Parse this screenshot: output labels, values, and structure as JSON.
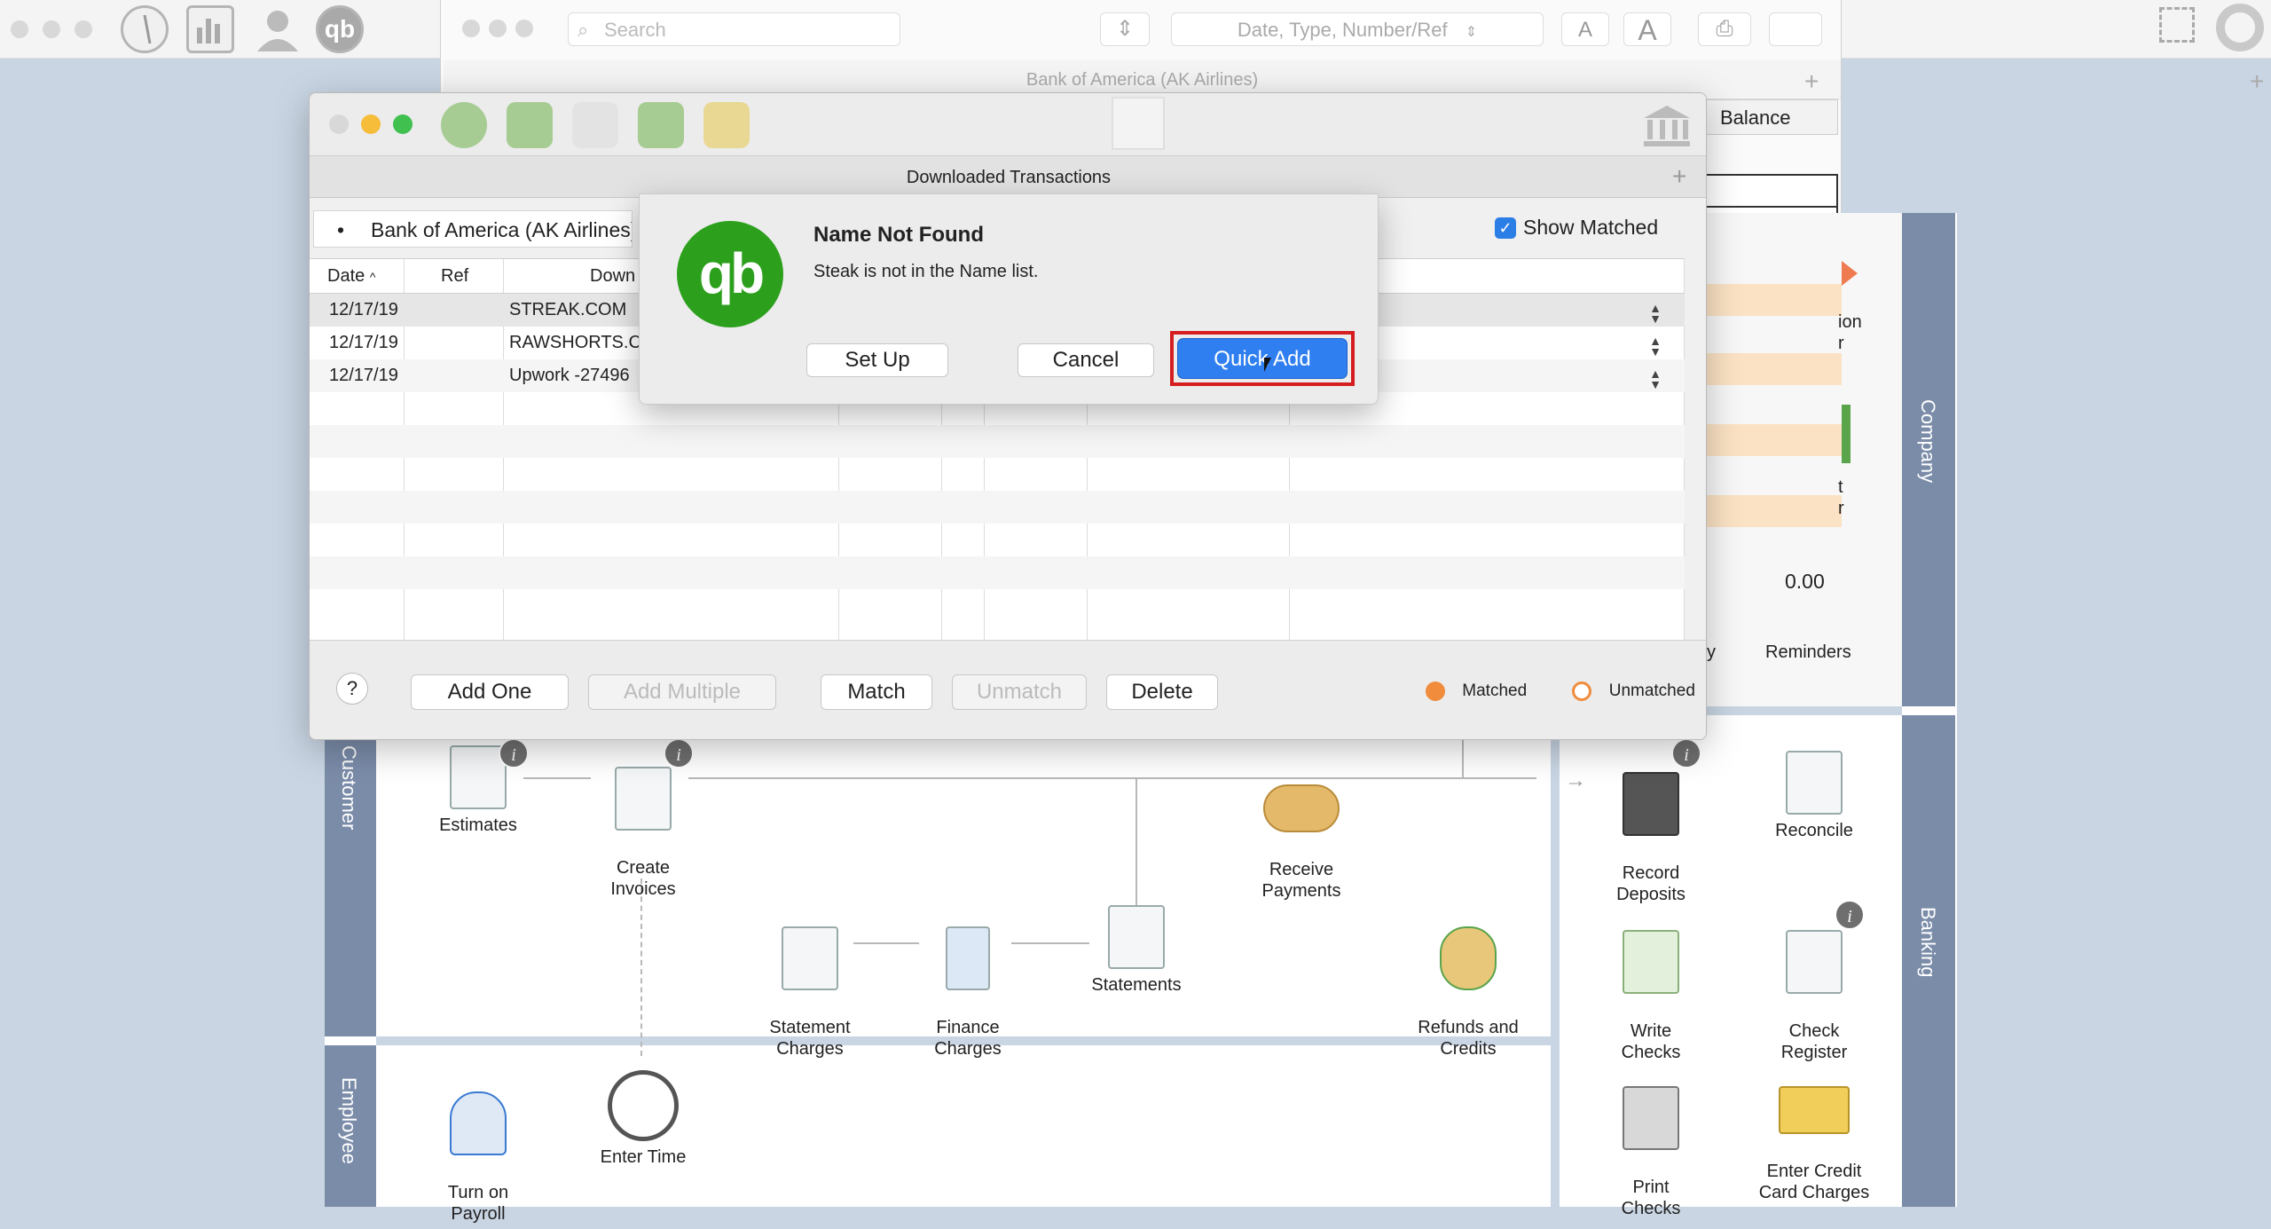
{
  "topbar": {
    "icons": [
      "traffic-lights",
      "compass-icon",
      "bar-chart-icon",
      "user-icon",
      "qb-icon"
    ],
    "search_placeholder": "Search",
    "sort_dropdown": "Date, Type, Number/Ref",
    "font_small": "A",
    "font_large": "A"
  },
  "register": {
    "title": "Bank of America (AK Airlines)",
    "balance_header": "Balance",
    "balance_value": "0.00",
    "side_labels": [
      "ion",
      "r",
      "t",
      "r"
    ],
    "reminders_label": "Reminders",
    "y_label": "y"
  },
  "home": {
    "tabs": {
      "customer": "Customer",
      "employee": "Employee",
      "company": "Company",
      "banking": "Banking"
    },
    "customer_items": [
      {
        "label": "Estimates"
      },
      {
        "label": "Create\nInvoices"
      },
      {
        "label": "Receive\nPayments"
      },
      {
        "label": "Statement\nCharges"
      },
      {
        "label": "Finance\nCharges"
      },
      {
        "label": "Statements"
      },
      {
        "label": "Refunds and\nCredits"
      }
    ],
    "employee_items": [
      {
        "label": "Turn on\nPayroll"
      },
      {
        "label": "Enter Time"
      }
    ],
    "banking_items": [
      {
        "label": "Record\nDeposits"
      },
      {
        "label": "Reconcile"
      },
      {
        "label": "Write\nChecks"
      },
      {
        "label": "Check\nRegister"
      },
      {
        "label": "Print\nChecks"
      },
      {
        "label": "Enter Credit\nCard Charges"
      }
    ]
  },
  "downloaded": {
    "window_title": "Downloaded Transactions",
    "account": "Bank of America (AK Airlines)",
    "show_matched_label": "Show Matched",
    "show_matched_checked": true,
    "columns": {
      "date": "Date",
      "ref": "Ref",
      "downloaded": "Down"
    },
    "rows": [
      {
        "date": "12/17/19",
        "desc": "STREAK.COM"
      },
      {
        "date": "12/17/19",
        "desc": "RAWSHORTS.C"
      },
      {
        "date": "12/17/19",
        "desc": "Upwork -27496"
      }
    ],
    "footer": {
      "help": "?",
      "add_one": "Add One",
      "add_multiple": "Add Multiple",
      "match": "Match",
      "unmatch": "Unmatch",
      "delete": "Delete",
      "matched": "Matched",
      "unmatched": "Unmatched"
    }
  },
  "alert": {
    "title": "Name Not Found",
    "message": "Steak is not in the Name list.",
    "setup": "Set Up",
    "cancel": "Cancel",
    "quick_add": "Quick Add"
  },
  "colors": {
    "accent": "#2f7ff0",
    "qb_green": "#2ca01c",
    "highlight": "#d51e20",
    "matched": "#f08c3c",
    "tab": "#7b8ca9"
  }
}
